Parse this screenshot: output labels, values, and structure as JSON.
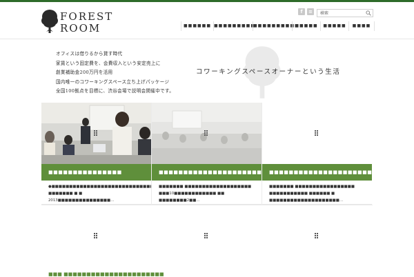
{
  "brand": {
    "line1": "FOREST",
    "line2": "ROOM"
  },
  "header": {
    "social": [
      {
        "icon": "facebook-icon",
        "glyph": "f"
      },
      {
        "icon": "rss-icon",
        "glyph": "≡"
      }
    ],
    "search": {
      "placeholder": "検索",
      "icon": "search-icon"
    }
  },
  "nav": {
    "items": [
      {
        "label": "■■■■■■"
      },
      {
        "label": "■■■■■■■■■"
      },
      {
        "label": "■■■■■■■■■■"
      },
      {
        "label": "■■■■■"
      },
      {
        "label": "■■■■■"
      },
      {
        "label": "■■■■"
      }
    ]
  },
  "hero": {
    "lines": [
      "オフィスは借りるから貸す時代",
      "家賃という固定費を、会費収入という安定売上に",
      "創業補助金200万円を活用",
      "国内唯一のコワーキングスペース立ち上げパッケージ",
      "全国100拠点を目標に、渋谷会場で説明会開催中です。"
    ],
    "tagline": "コワーキングスペースオーナーという生活"
  },
  "cards": [
    {
      "title": "■■■■■■■■■■■■■■■",
      "excerpt": "●■■■■■■■■■■■■■■■■■■■■■■■■■■■■■■■■■■■■■■■■■■ ■■■■■■■ ■ ■ 2013■■■■■■■■■■■■■■■…"
    },
    {
      "title": "■■■■■■■■■■■■■■■■■■■■■■■■■■",
      "excerpt": "■■■■■■■ ■■■■■■■■■■■■■■■■■■■ ■■■10■■■■■■■■■■■■ ■■ ■■■■■■■■2■■…"
    },
    {
      "title": "■■■■■■■■■■■■■■■■■■■■■■",
      "excerpt": "■■■■■■■ ■■■■■■■■■■■■■■■■■ ■■■■■■■■■■■ ■■■■■■ ■ ■■■■■■■■■■■■■■■■■■■■…"
    }
  ],
  "bottom_partial_title": "■■■ ■■■■■■■■■■■■■■■■■■■■■■"
}
